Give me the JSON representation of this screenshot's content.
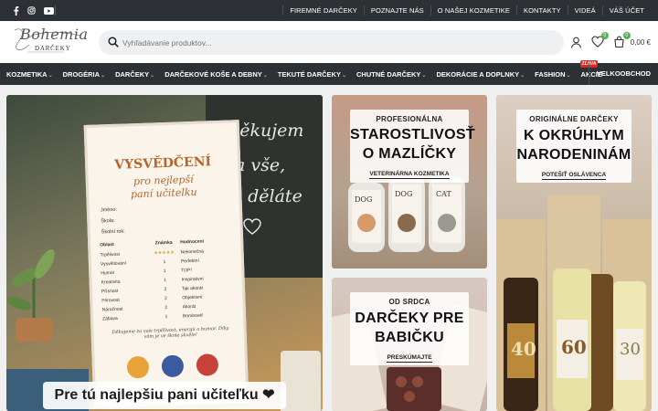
{
  "topbar": {
    "social": [
      "facebook-icon",
      "instagram-icon",
      "youtube-icon"
    ],
    "links": [
      "FIREMNÉ DARČEKY",
      "POZNAJTE NÁS",
      "O NAŠEJ KOZMETIKE",
      "KONTAKTY",
      "VIDEÁ",
      "VÁŠ ÚČET"
    ]
  },
  "logo": {
    "script": "Bohemia",
    "sub": "DARČEKY"
  },
  "search": {
    "placeholder": "Vyhľadávanie produktov..."
  },
  "header": {
    "wishlist_count": "0",
    "cart_count": "0",
    "cart_total": "0,00 €"
  },
  "nav": {
    "items": [
      {
        "label": "KOZMETIKA",
        "chev": "⌄"
      },
      {
        "label": "DROGÉRIA",
        "chev": "⌄"
      },
      {
        "label": "DARČEKY",
        "chev": "⌄"
      },
      {
        "label": "DARČEKOVÉ KOŠE A DEBNY",
        "chev": "⌄"
      },
      {
        "label": "TEKUTÉ DARČEKY",
        "chev": "⌄"
      },
      {
        "label": "CHUTNÉ DARČEKY",
        "chev": "⌄"
      },
      {
        "label": "DEKORÁCIE A DOPLNKY",
        "chev": "⌄"
      },
      {
        "label": "FASHION",
        "chev": "⌄"
      },
      {
        "label": "AKCIE",
        "chev": "",
        "badge": "ZĽAVA"
      }
    ],
    "wholesale": "VELKOOBCHOD"
  },
  "banner_main": {
    "caption": "Pre tú najlepšiu pani učiteľku ❤",
    "chalk": [
      "Děkujem",
      "za vše,",
      "co děláte"
    ],
    "cert_title": "VYSVĚDČENÍ",
    "cert_sub1": "pro nejlepší",
    "cert_sub2": "paní učitelku",
    "cert_fields": [
      "Jméno:",
      "Škola:",
      "Školní rok:"
    ],
    "cert_head": [
      "Oblast",
      "Známka",
      "Hodnocení"
    ],
    "cert_rows": [
      [
        "Trpělivost",
        "★★★★★",
        "Nekonečná"
      ],
      [
        "Vysvětlování",
        "1",
        "Perfektní"
      ],
      [
        "Humor",
        "1",
        "TOP!"
      ],
      [
        "Kreativita",
        "1",
        "Inspirativní"
      ],
      [
        "Přísnost",
        "2",
        "Tak akorát"
      ],
      [
        "Férovost",
        "2",
        "Objektivní"
      ],
      [
        "Náročnost",
        "2",
        "Akorát"
      ],
      [
        "Zábava",
        "1",
        "Bombové!"
      ]
    ],
    "cert_note": "Děkujeme za vaši trpělivost, energii a humor. Díky vám je ve škole skvěle!"
  },
  "banner_pets": {
    "pre": "PROFESIONÁLNA",
    "big1": "STAROSTLIVOSŤ",
    "big2": "O MAZLÍČKY",
    "link": "VETERINÁRNA KOZMETIKA",
    "labels": [
      "DOG",
      "DOG",
      "CAT"
    ]
  },
  "banner_grandma": {
    "pre": "OD SRDCA",
    "big1": "DARČEKY PRE",
    "big2": "BABIČKU",
    "link": "PRESKÚMAJTE"
  },
  "banner_birthday": {
    "pre": "ORIGINÁLNE DARČEKY",
    "big1": "K OKRÚHLYM",
    "big2": "NARODENINÁM",
    "link": "POTEŠIŤ OSLÁVENCA",
    "numbers": [
      "40",
      "60",
      "30"
    ]
  }
}
